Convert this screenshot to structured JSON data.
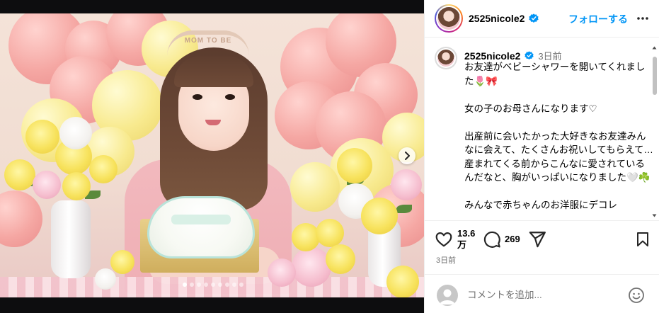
{
  "post": {
    "username": "2525nicole2",
    "follow_label": "フォローする",
    "more_icon": "more-horizontal-icon",
    "verified_icon": "verified-badge-icon"
  },
  "caption": {
    "username": "2525nicole2",
    "time_ago": "3日前",
    "text": "お友達がベビーシャワーを開いてくれました🌷🎀\n\n女の子のお母さんになります♡\n\n出産前に会いたかった大好きなお友達みんなに会えて、たくさんお祝いしてもらえて…\n産まれてくる前からこんなに愛されているんだなと、胸がいっぱいになりました🤍☘️\n\nみんなで赤ちゃんのお洋服にデコレ"
  },
  "media": {
    "tiara_text": "MOM TO BE",
    "slide_count": 9,
    "active_slide": 1
  },
  "actions": {
    "like_count": "13.6\n万",
    "comment_count": "269",
    "icons": [
      "heart-icon",
      "comment-icon",
      "share-icon",
      "bookmark-icon"
    ]
  },
  "footer": {
    "post_time": "3日前",
    "comment_placeholder": "コメントを追加...",
    "emoji_icon": "emoji-icon"
  },
  "colors": {
    "accent": "#0095f6",
    "verified": "#0095f6",
    "muted": "#737373"
  }
}
